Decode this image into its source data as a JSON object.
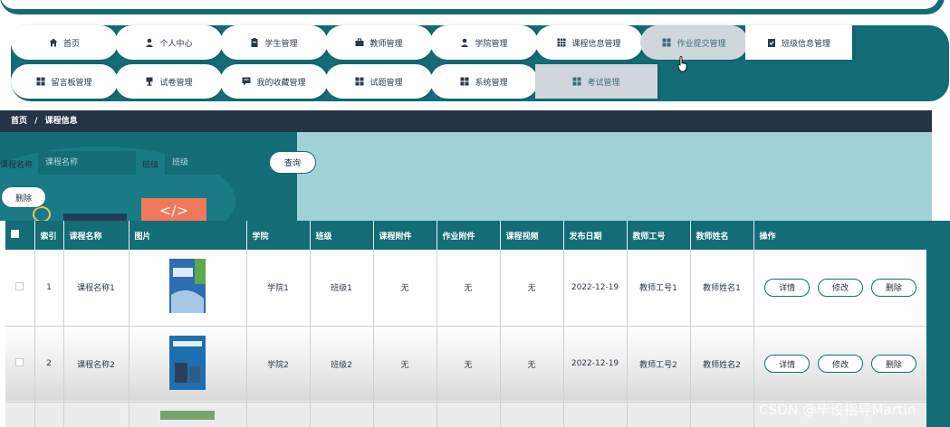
{
  "nav": {
    "row1": [
      {
        "label": "首页",
        "icon": "home-icon"
      },
      {
        "label": "个人中心",
        "icon": "user-icon"
      },
      {
        "label": "学生管理",
        "icon": "clipboard-icon"
      },
      {
        "label": "教师管理",
        "icon": "briefcase-icon"
      },
      {
        "label": "学院管理",
        "icon": "user-icon"
      },
      {
        "label": "课程信息管理",
        "icon": "grid-icon"
      },
      {
        "label": "作业提交管理",
        "icon": "grid-icon",
        "active": true
      },
      {
        "label": "班级信息管理",
        "icon": "check-clipboard-icon"
      }
    ],
    "row2": [
      {
        "label": "留言板管理",
        "icon": "grid-icon"
      },
      {
        "label": "试卷管理",
        "icon": "cup-icon"
      },
      {
        "label": "我的收藏管理",
        "icon": "chat-icon"
      },
      {
        "label": "试题管理",
        "icon": "grid-icon"
      },
      {
        "label": "系统管理",
        "icon": "grid-icon"
      },
      {
        "label": "考试管理",
        "icon": "grid-icon",
        "active": true
      }
    ]
  },
  "breadcrumb": {
    "home": "首页",
    "sep": "/",
    "current": "课程信息"
  },
  "search": {
    "course_label": "课程名称",
    "course_placeholder": "课程名称",
    "class_label": "班级",
    "class_placeholder": "班级",
    "query_button": "查询",
    "delete_button": "删除"
  },
  "table": {
    "headers": [
      "索引",
      "课程名称",
      "图片",
      "学院",
      "班级",
      "课程附件",
      "作业附件",
      "课程视频",
      "发布日期",
      "教师工号",
      "教师姓名",
      "操作"
    ],
    "rows": [
      {
        "index": "1",
        "course": "课程名称1",
        "college": "学院1",
        "class": "班级1",
        "course_file": "无",
        "homework_file": "无",
        "video": "无",
        "date": "2022-12-19",
        "teacher_id": "教师工号1",
        "teacher_name": "教师姓名1"
      },
      {
        "index": "2",
        "course": "课程名称2",
        "college": "学院2",
        "class": "班级2",
        "course_file": "无",
        "homework_file": "无",
        "video": "无",
        "date": "2022-12-19",
        "teacher_id": "教师工号2",
        "teacher_name": "教师姓名2"
      }
    ],
    "actions": {
      "detail": "详情",
      "edit": "修改",
      "delete": "删除"
    }
  },
  "watermark": "CSDN @毕设指导Martin",
  "colors": {
    "teal": "#136c76",
    "navy": "#263447",
    "light": "#a3d1da",
    "active_tab": "#cfd6dc"
  }
}
